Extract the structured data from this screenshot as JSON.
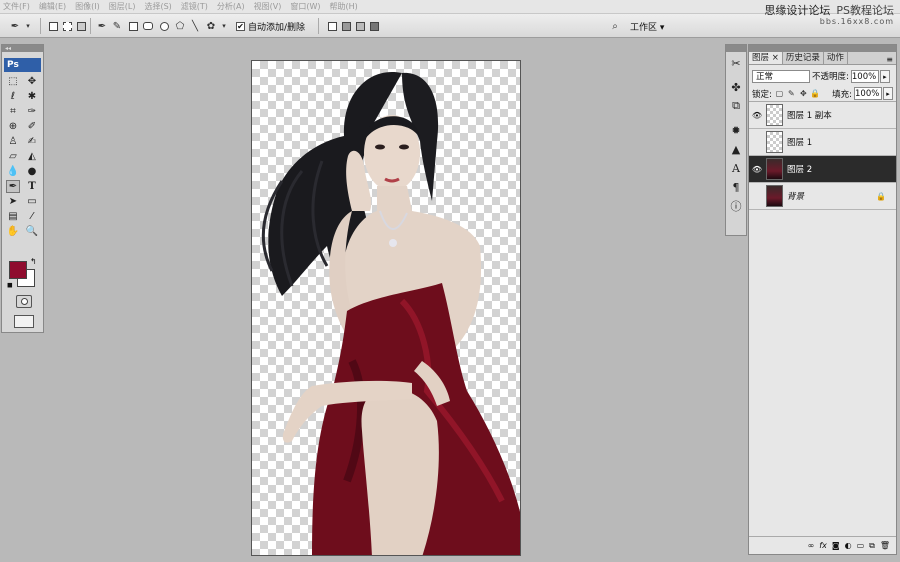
{
  "menu": [
    "文件(F)",
    "编辑(E)",
    "图像(I)",
    "图层(L)",
    "选择(S)",
    "滤镜(T)",
    "分析(A)",
    "视图(V)",
    "窗口(W)",
    "帮助(H)"
  ],
  "watermark": {
    "line1": "思缘设计论坛",
    "line2": "PS教程论坛",
    "line3": "bbs.16xx8.com"
  },
  "options": {
    "auto_add_delete": "自动添加/删除",
    "auto_add_checked": "✔",
    "workspace": "工作区 ▾"
  },
  "toolbox": {
    "logo": "Ps"
  },
  "colors": {
    "foreground": "#8f0c2e",
    "background": "#ffffff"
  },
  "panel": {
    "tabs": [
      "图层 ×",
      "历史记录",
      "动作"
    ],
    "blend_mode": "正常",
    "opacity_label": "不透明度:",
    "opacity": "100%",
    "lock_label": "锁定:",
    "fill_label": "填充:",
    "fill": "100%",
    "layers": [
      {
        "name": "图层 1 副本",
        "visible": true,
        "selected": false,
        "thumb": "transparent"
      },
      {
        "name": "图层 1",
        "visible": false,
        "selected": false,
        "thumb": "transparent"
      },
      {
        "name": "图层 2",
        "visible": true,
        "selected": true,
        "thumb": "photo"
      },
      {
        "name": "背景",
        "visible": false,
        "selected": false,
        "thumb": "photo",
        "locked": true
      }
    ]
  }
}
